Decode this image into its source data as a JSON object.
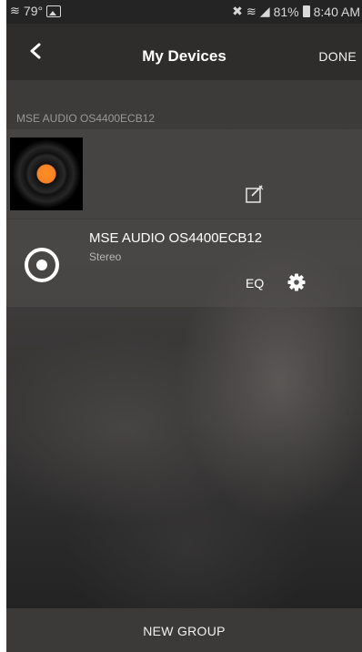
{
  "status_bar": {
    "left_text": "79°",
    "battery": "81%",
    "time": "8:40 AM"
  },
  "header": {
    "back_icon": "chevron-left-icon",
    "title": "My Devices",
    "done_label": "DONE"
  },
  "group": {
    "section_label": "MSE AUDIO OS4400ECB12",
    "edit_icon": "edit-icon"
  },
  "device": {
    "name": "MSE AUDIO OS4400ECB12",
    "subtitle": "Stereo",
    "eq_label": "EQ",
    "settings_icon": "gear-icon"
  },
  "footer": {
    "new_group_label": "NEW GROUP"
  },
  "colors": {
    "header_bg": "#2e2d2c",
    "album_accent": "#f5822a"
  }
}
